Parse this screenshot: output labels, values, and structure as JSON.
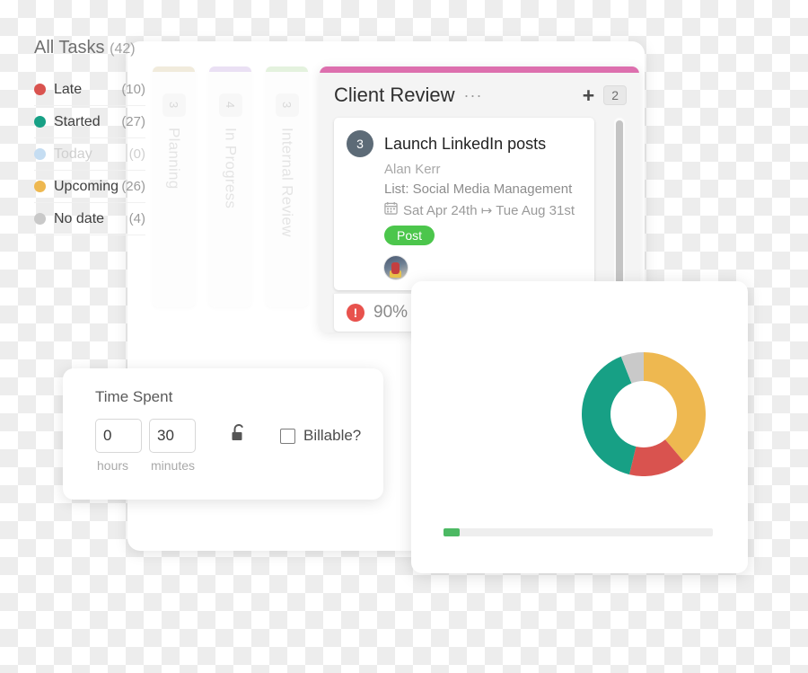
{
  "board": {
    "collapsed_columns": [
      {
        "title": "Planning",
        "count": "3",
        "color": "#e6dcc0"
      },
      {
        "title": "In Progress",
        "count": "4",
        "color": "#d9c7ec"
      },
      {
        "title": "Internal Review",
        "count": "3",
        "color": "#cfe8c4"
      }
    ],
    "active_column": {
      "title": "Client Review",
      "accent_color": "#dd6fae",
      "more_icon": "···",
      "add_icon": "+",
      "count_badge": "2",
      "card": {
        "number": "3",
        "title": "Launch LinkedIn posts",
        "assignee": "Alan Kerr",
        "list": "List: Social Media Management",
        "calendar_icon": "Ὄ5",
        "date_range": "Sat Apr 24th ↦ Tue Aug 31st",
        "tag": "Post",
        "tag_color": "#4cc64c",
        "avatar_name": "avatar"
      },
      "progress": {
        "alert_icon": "!",
        "percent": "90%",
        "alert_color": "#e8524d"
      }
    }
  },
  "time_spent": {
    "title": "Time Spent",
    "hours_value": "0",
    "hours_label": "hours",
    "minutes_value": "30",
    "minutes_label": "minutes",
    "lock_icon": "unlock-icon",
    "billable_label": "Billable?",
    "billable_checked": false
  },
  "all_tasks": {
    "title": "All Tasks",
    "total": "(42)",
    "progress_percent": 6,
    "progress_fill_color": "#4cb963",
    "legend": [
      {
        "label": "Late",
        "count": "(10)",
        "color": "#d9534f",
        "muted": false
      },
      {
        "label": "Started",
        "count": "(27)",
        "color": "#17a085",
        "muted": false
      },
      {
        "label": "Today",
        "count": "(0)",
        "color": "#c5ddf2",
        "muted": true
      },
      {
        "label": "Upcoming",
        "count": "(26)",
        "color": "#eeb850",
        "muted": false
      },
      {
        "label": "No date",
        "count": "(4)",
        "color": "#c9c9c9",
        "muted": false
      }
    ]
  },
  "chart_data": {
    "type": "pie",
    "title": "All Tasks",
    "subtitle": "(42)",
    "categories": [
      "Upcoming",
      "Late",
      "Started",
      "No date",
      "Today"
    ],
    "values": [
      26,
      10,
      27,
      4,
      0
    ],
    "colors": [
      "#eeb850",
      "#d9534f",
      "#17a085",
      "#c9c9c9",
      "#c5ddf2"
    ],
    "total": 42,
    "donut": true,
    "inner_radius_ratio": 0.54,
    "start_angle_deg": 0,
    "direction": "clockwise",
    "legend_position": "left",
    "xlabel": "",
    "ylabel": ""
  }
}
